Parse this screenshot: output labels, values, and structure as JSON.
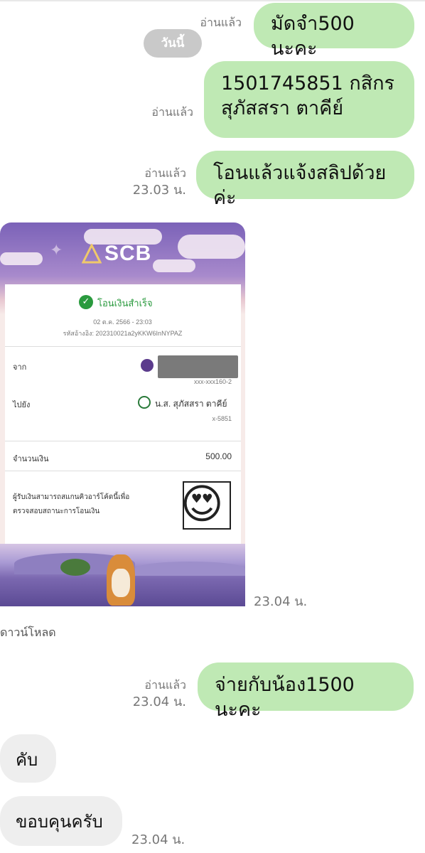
{
  "messages": {
    "m1": {
      "text": "มัดจำ500 นะคะ",
      "read": "อ่านแล้ว"
    },
    "date_chip": "วันนี้",
    "m2": {
      "line1": "1501745851 กสิกร",
      "line2": "สุภัสสรา ตาคีย์",
      "read": "อ่านแล้ว"
    },
    "m3": {
      "text": "โอนแล้วแจ้งสลิปด้วยค่ะ",
      "read": "อ่านแล้ว",
      "time": "23.03 น."
    },
    "slip_time": "23.04 น.",
    "download": "ดาวน์โหลด",
    "m4": {
      "text": "จ่ายกับน้อง1500 นะคะ",
      "read": "อ่านแล้ว",
      "time": "23.04 น."
    },
    "m5": {
      "text": "คับ"
    },
    "m6": {
      "text": "ขอบคุนครับ",
      "time": "23.04 น."
    }
  },
  "slip": {
    "bank": "SCB",
    "status": "โอนเงินสำเร็จ",
    "datetime": "02 ต.ค. 2566 - 23:03",
    "ref": "รหัสอ้างอิง: 202310021a2yKKW6InNYPAZ",
    "from_label": "จาก",
    "from_account": "xxx-xxx160-2",
    "to_label": "ไปยัง",
    "to_name": "น.ส. สุภัสสรา ตาคีย์",
    "to_account": "x-5851",
    "amount_label": "จำนวนเงิน",
    "amount": "500.00",
    "qr_note_1": "ผู้รับเงินสามารถสแกนคิวอาร์โค้ดนี้เพื่อ",
    "qr_note_2": "ตรวจสอบสถานะการโอนเงิน",
    "emoji": "😍"
  },
  "colors": {
    "outgoing_bubble": "#bfe9b4",
    "incoming_bubble": "#eeeeee",
    "scb_purple": "#7b62b8"
  }
}
